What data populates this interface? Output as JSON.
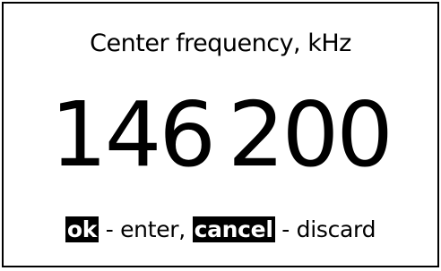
{
  "dialog": {
    "title": "Center frequency, kHz",
    "value": {
      "mhz_part": "146",
      "khz_part": "200"
    },
    "hint": {
      "ok_key": "ok",
      "ok_text": " - enter, ",
      "cancel_key": "cancel",
      "cancel_text": " - discard"
    }
  },
  "colors": {
    "background": "#ffffff",
    "foreground": "#000000"
  }
}
